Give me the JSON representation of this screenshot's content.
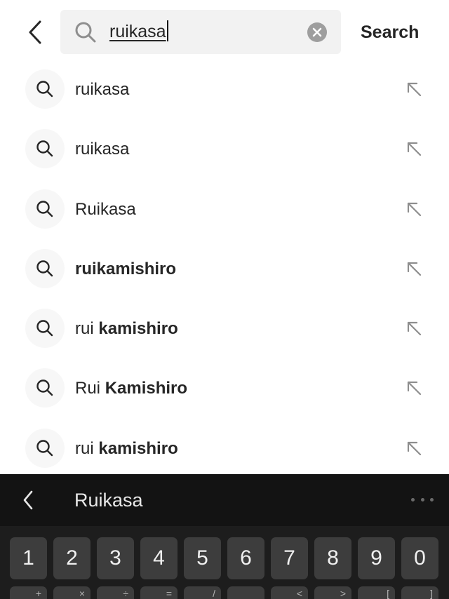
{
  "header": {
    "search_query": "ruikasa",
    "search_action_label": "Search"
  },
  "suggestions": [
    {
      "plain": "ruikasa",
      "bold": ""
    },
    {
      "plain": "ruikasa",
      "bold": ""
    },
    {
      "plain": "Ruikasa",
      "bold": ""
    },
    {
      "plain": "",
      "bold": "ruikamishiro"
    },
    {
      "plain": "rui ",
      "bold": "kamishiro"
    },
    {
      "plain": "Rui ",
      "bold": "Kamishiro"
    },
    {
      "plain": "rui ",
      "bold": "kamishiro"
    }
  ],
  "keyboard": {
    "suggestion_word": "Ruikasa",
    "number_row": [
      "1",
      "2",
      "3",
      "4",
      "5",
      "6",
      "7",
      "8",
      "9",
      "0"
    ],
    "symbol_row": [
      "+",
      "×",
      "÷",
      "=",
      "/",
      "",
      "<",
      ">",
      "[",
      "]"
    ]
  },
  "colors": {
    "text": "#262626",
    "search_bg": "#f2f2f2",
    "keyboard_bg": "#141414",
    "key_bg": "#3d3d3d"
  }
}
